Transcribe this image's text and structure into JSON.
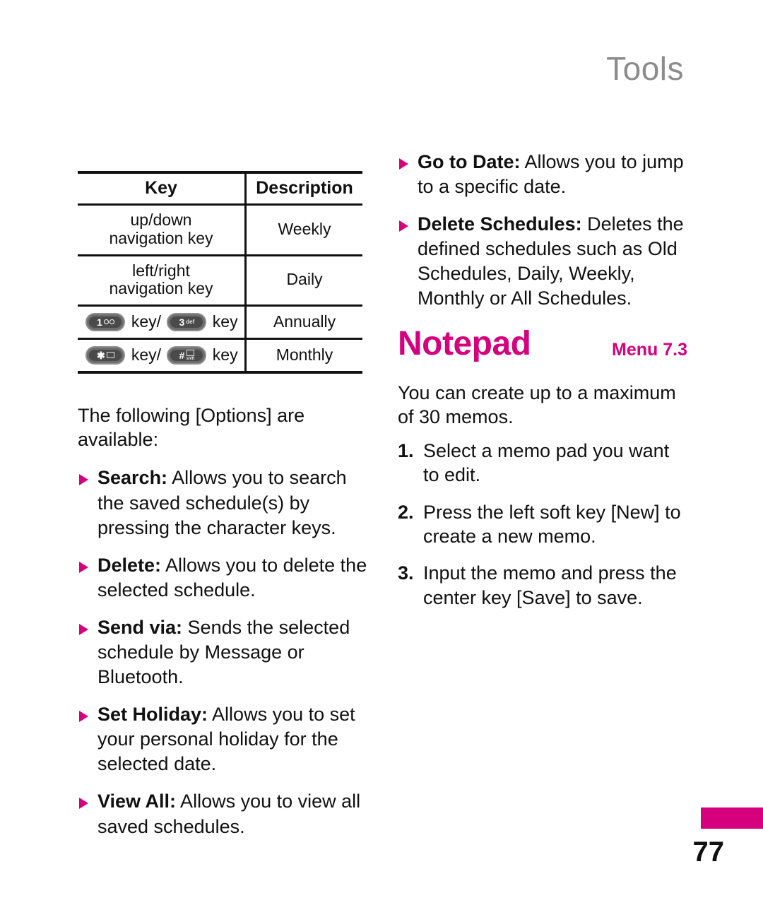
{
  "header": {
    "chapter_title": "Tools",
    "chapter_color": "#8c8c8c"
  },
  "colors": {
    "accent_magenta": "#D6007F",
    "text": "#111111",
    "key_pill_fill": "#4a4a4a",
    "key_pill_border": "#8f8f8f"
  },
  "left_column": {
    "key_table": {
      "headers": {
        "key": "Key",
        "description": "Description"
      },
      "rows": [
        {
          "key_type": "text",
          "key_text": "up/down\nnavigation key",
          "key_line1": "up/down",
          "key_line2": "navigation key",
          "description": "Weekly"
        },
        {
          "key_type": "text",
          "key_text": "left/right\nnavigation key",
          "key_line1": "left/right",
          "key_line2": "navigation key",
          "description": "Daily"
        },
        {
          "key_type": "keys",
          "key_first_label": "1",
          "key_first_icon": "voicemail-icon",
          "key_word_1": "key/",
          "key_second_label": "3",
          "key_second_sub": "def",
          "key_word_2": "key",
          "description": "Annually"
        },
        {
          "key_type": "keys",
          "key_first_label": "✱",
          "key_first_icon": "star-symbol-icon",
          "key_word_1": "key/",
          "key_second_label": "#",
          "key_second_sub": "shift",
          "key_word_2": "key",
          "description": "Monthly"
        }
      ]
    },
    "intro_paragraph": "The following [Options] are available:",
    "options": [
      {
        "term": "Search:",
        "text": " Allows you to search the saved schedule(s) by pressing the character keys."
      },
      {
        "term": "Delete:",
        "text": " Allows you to delete the selected schedule."
      },
      {
        "term": "Send via:",
        "text": " Sends the selected schedule by Message or Bluetooth."
      },
      {
        "term": "Set Holiday:",
        "text": " Allows you to set your personal holiday for the selected date."
      },
      {
        "term": "View All:",
        "text": " Allows you to view all saved schedules."
      }
    ]
  },
  "right_column": {
    "options": [
      {
        "term": "Go to Date:",
        "text": " Allows you to jump to a specific date."
      },
      {
        "term": "Delete Schedules:",
        "text": " Deletes the defined schedules such as Old Schedules, Daily, Weekly, Monthly or All Schedules."
      }
    ],
    "section": {
      "title": "Notepad",
      "menu_ref": "Menu 7.3",
      "intro": "You can create up to a maximum of 30 memos.",
      "steps": [
        {
          "num": "1.",
          "text": "Select a memo pad you want to edit."
        },
        {
          "num": "2.",
          "text": "Press the left soft key [New] to create a new memo."
        },
        {
          "num": "3.",
          "text": "Input the memo and press the center key [Save] to save."
        }
      ]
    }
  },
  "footer": {
    "page_number": "77"
  }
}
